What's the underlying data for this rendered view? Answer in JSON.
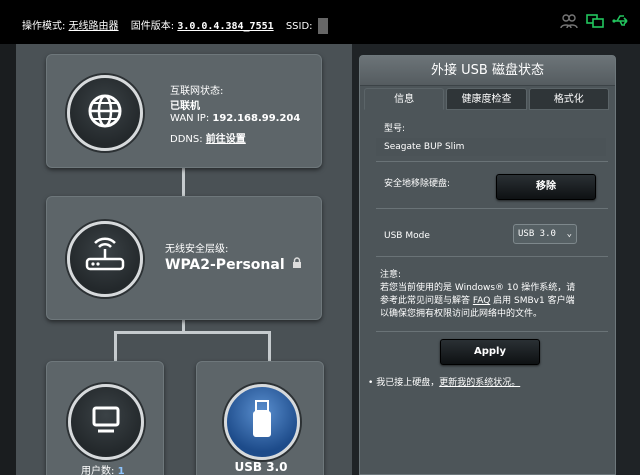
{
  "topbar": {
    "mode_label": "操作模式:",
    "mode_value": "无线路由器",
    "firmware_label": "固件版本:",
    "firmware_value": "3.0.0.4.384_7551",
    "ssid_label": "SSID:",
    "icons": [
      "users-icon",
      "network-status-icon",
      "usb-icon"
    ],
    "accent_color": "#22c55e"
  },
  "map": {
    "internet": {
      "status_label": "互联网状态:",
      "status_value": "已联机",
      "wan_ip_label": "WAN IP:",
      "wan_ip_value": "192.168.99.204",
      "ddns_label": "DDNS:",
      "ddns_value": "前往设置",
      "icon": "globe-icon"
    },
    "wireless": {
      "security_label": "无线安全层级:",
      "security_value": "WPA2-Personal",
      "icon": "router-icon",
      "lock_icon": "lock-icon"
    },
    "clients": {
      "label": "用户数:",
      "count": "1",
      "icon": "monitor-icon"
    },
    "usb": {
      "label": "USB 3.0",
      "icon": "usb-drive-icon"
    }
  },
  "panel": {
    "title": "外接 USB 磁盘状态",
    "tabs": [
      {
        "label": "信息"
      },
      {
        "label": "健康度检查"
      },
      {
        "label": "格式化"
      }
    ],
    "model_label": "型号:",
    "model_value": "Seagate BUP Slim",
    "safe_remove_label": "安全地移除硬盘:",
    "remove_button": "移除",
    "usb_mode_label": "USB Mode",
    "usb_mode_value": "USB 3.0",
    "note_title": "注意:",
    "note_text_1": "若您当前使用的是 Windows® 10 操作系统，请",
    "note_text_2": "参考此常见问题与解答 ",
    "note_faq": "FAQ",
    "note_text_3": " 启用 SMBv1 客户端",
    "note_text_4": "以确保您拥有权限访问此网络中的文件。",
    "apply_button": "Apply",
    "status_bullet": "•",
    "status_text": "我已接上硬盘，",
    "status_link": "更新我的系统状况。"
  }
}
